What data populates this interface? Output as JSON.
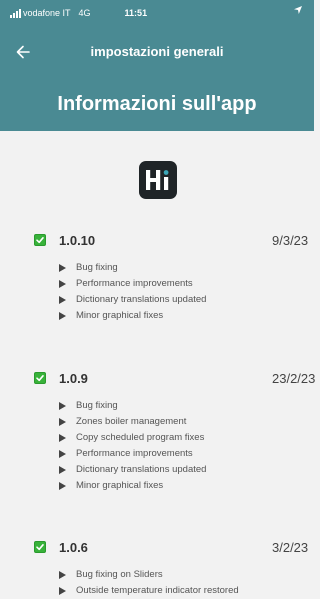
{
  "status_bar": {
    "carrier": "vodafone IT",
    "network": "4G",
    "time": "11:51"
  },
  "nav": {
    "back_icon": "arrow-left-icon",
    "title": "impostazioni generali"
  },
  "page_title": "Informazioni sull'app",
  "colors": {
    "header": "#4a8a93",
    "check": "#38b23a",
    "logo_bg": "#1f2427"
  },
  "versions": [
    {
      "number": "1.0.10",
      "date": "9/3/23",
      "notes": [
        "Bug fixing",
        "Performance improvements",
        "Dictionary translations updated",
        "Minor graphical fixes"
      ]
    },
    {
      "number": "1.0.9",
      "date": "23/2/23",
      "notes": [
        "Bug fixing",
        "Zones boiler management",
        "Copy scheduled program fixes",
        "Performance improvements",
        "Dictionary translations updated",
        "Minor graphical fixes"
      ]
    },
    {
      "number": "1.0.6",
      "date": "3/2/23",
      "notes": [
        "Bug fixing on Sliders",
        "Outside temperature indicator restored"
      ]
    }
  ]
}
